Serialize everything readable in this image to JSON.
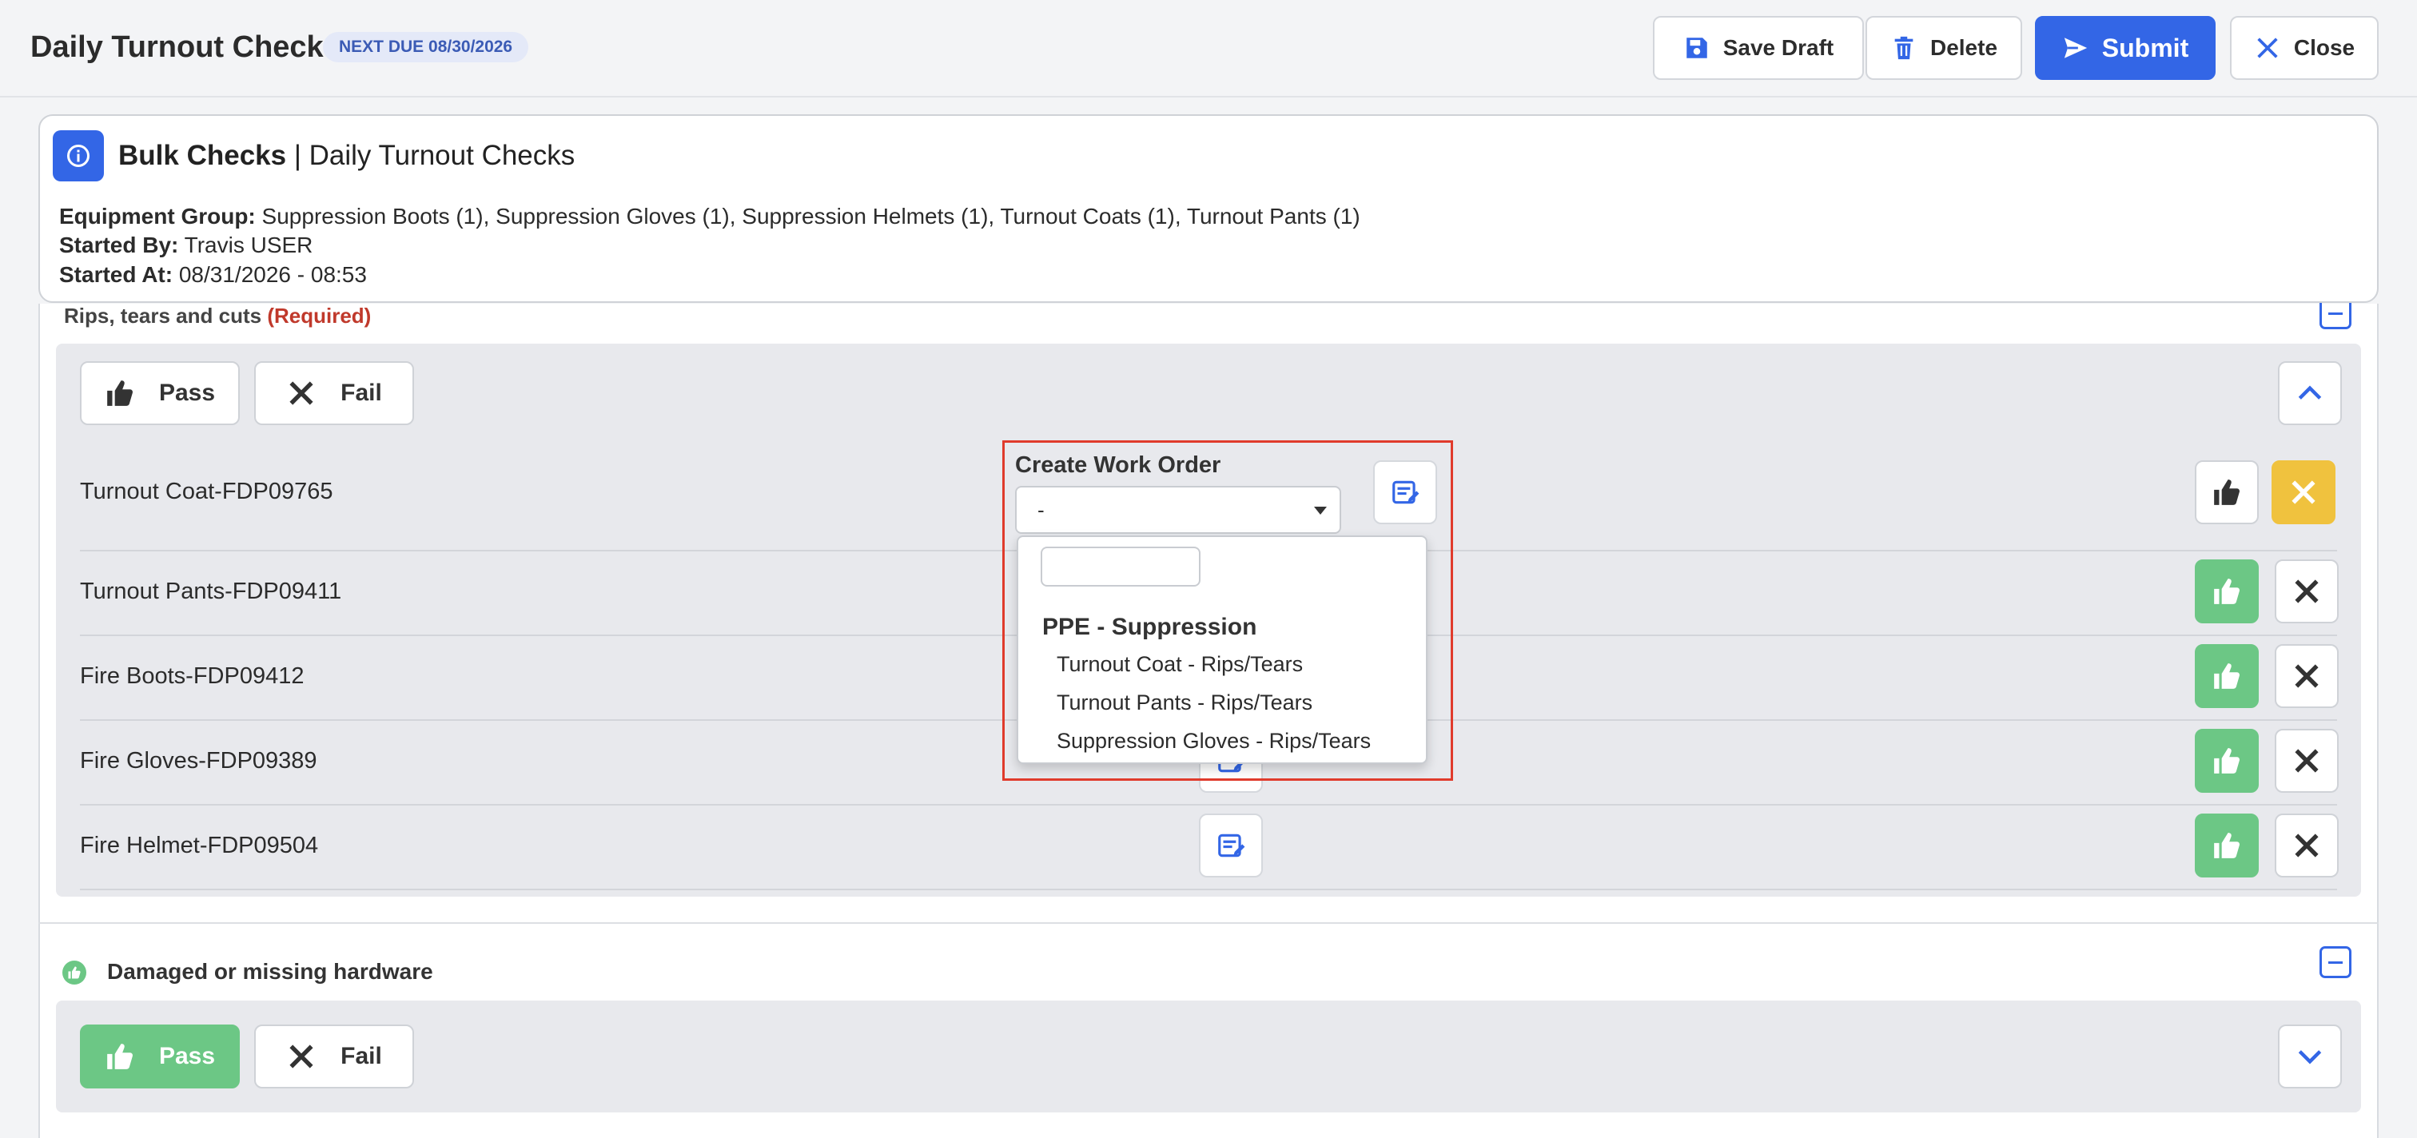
{
  "header": {
    "title": "Daily Turnout Checks",
    "due_badge": "NEXT DUE 08/30/2026",
    "buttons": {
      "save_draft": "Save Draft",
      "delete": "Delete",
      "submit": "Submit",
      "close": "Close"
    }
  },
  "info": {
    "title_bold": "Bulk Checks",
    "title_rest": " | Daily Turnout Checks",
    "equipment_label": "Equipment Group:",
    "equipment_value": " Suppression Boots (1), Suppression Gloves (1), Suppression Helmets (1), Turnout Coats (1), Turnout Pants (1)",
    "started_by_label": "Started By:",
    "started_by_value": " Travis USER",
    "started_at_label": "Started At:",
    "started_at_value": " 08/31/2026 - 08:53"
  },
  "section1": {
    "title": "Rips, tears and cuts",
    "required": "(Required)",
    "pass_label": "Pass",
    "fail_label": "Fail",
    "items": [
      "Turnout Coat-FDP09765",
      "Turnout Pants-FDP09411",
      "Fire Boots-FDP09412",
      "Fire Gloves-FDP09389",
      "Fire Helmet-FDP09504"
    ],
    "item_status": [
      "fail",
      "pass",
      "pass",
      "pass",
      "pass"
    ]
  },
  "work_order": {
    "label": "Create Work Order",
    "selected": "-",
    "search_value": "",
    "group": "PPE - Suppression",
    "options": [
      "Turnout Coat - Rips/Tears",
      "Turnout Pants - Rips/Tears",
      "Suppression Gloves - Rips/Tears"
    ]
  },
  "section2": {
    "title": "Damaged or missing hardware",
    "pass_label": "Pass",
    "fail_label": "Fail",
    "status": "pass"
  },
  "colors": {
    "primary": "#3366e6",
    "pass_green": "#6cc785",
    "fail_yellow": "#f0c23e",
    "highlight_red": "#e03b2c"
  }
}
